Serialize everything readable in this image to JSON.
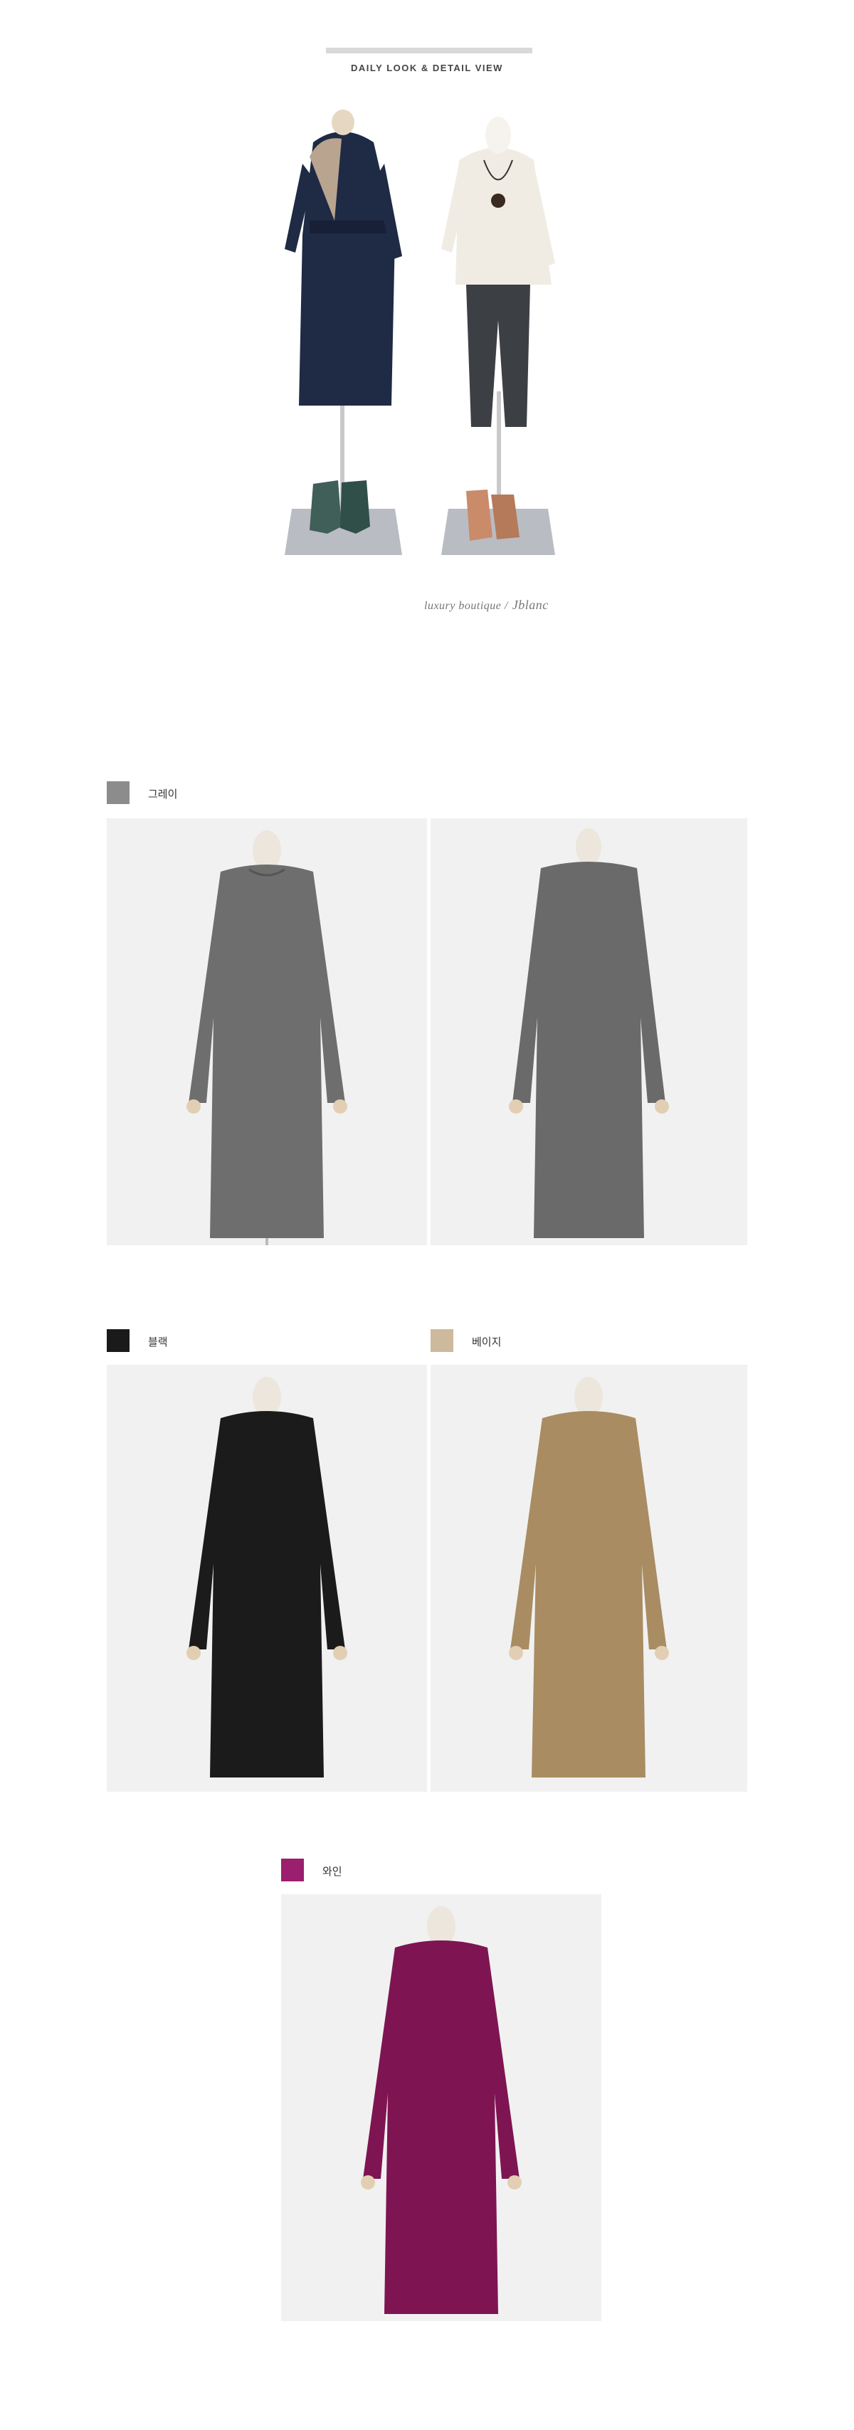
{
  "header": {
    "title": "DAILY LOOK & DETAIL VIEW"
  },
  "brand": {
    "caption": "luxury boutique /",
    "signature": "Jblanc"
  },
  "colors_meta": {
    "gray": "#8c8c8c",
    "black": "#1a1a1a",
    "beige": "#cdb99c",
    "wine": "#9b1f6e"
  },
  "options": [
    {
      "key": "gray",
      "label": "그레이",
      "swatch": "#8c8c8c"
    },
    {
      "key": "black",
      "label": "블랙",
      "swatch": "#1a1a1a"
    },
    {
      "key": "beige",
      "label": "베이지",
      "swatch": "#cdb99c"
    },
    {
      "key": "wine",
      "label": "와인",
      "swatch": "#9b1f6e"
    }
  ],
  "dress_colors": {
    "gray": "#6e6e6e",
    "black": "#1b1b1b",
    "beige": "#a98c62",
    "wine": "#7e1552"
  }
}
